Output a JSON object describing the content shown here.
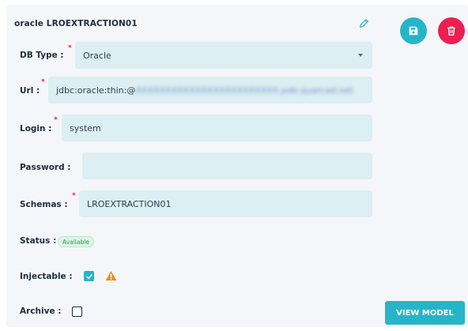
{
  "connection": {
    "title": "oracle LROEXTRACTION01"
  },
  "form": {
    "db_type": {
      "label": "DB Type :",
      "value": "Oracle",
      "required": true
    },
    "url": {
      "label": "Url :",
      "value_prefix": "jdbc:oracle:thin:@",
      "value_obscured": "XXXXXXXXXXXXXXXXXXXXXXXX.pdb.quarcad.net",
      "required": true
    },
    "login": {
      "label": "Login :",
      "value": "system",
      "required": true
    },
    "password": {
      "label": "Password :",
      "value": ""
    },
    "schemas": {
      "label": "Schemas :",
      "value": "LROEXTRACTION01",
      "required": true
    },
    "status": {
      "label": "Status :",
      "badge": "Available",
      "badge_color": "#2c9c58"
    },
    "injectable": {
      "label": "Injectable :",
      "checked": true
    },
    "archive": {
      "label": "Archive :",
      "checked": false
    }
  },
  "actions": {
    "view_model_label": "VIEW MODEL",
    "save_icon": "save-icon",
    "delete_icon": "trash-icon",
    "edit_icon": "pencil-icon",
    "warning_icon": "warning-triangle-icon"
  },
  "colors": {
    "accent": "#26b5c8",
    "danger": "#ec1e52",
    "warning": "#f08c1a",
    "field_bg": "#dceff2",
    "card_bg": "#f4f6f9"
  }
}
